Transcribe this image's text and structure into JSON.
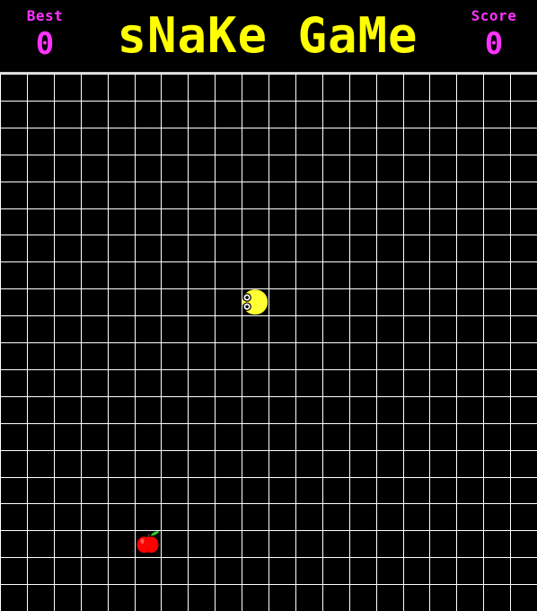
{
  "header": {
    "title": "sNaKe GaMe",
    "best": {
      "label": "Best",
      "value": "0"
    },
    "score": {
      "label": "Score",
      "value": "0"
    }
  },
  "colors": {
    "background": "#000000",
    "grid": "#ffffff",
    "title": "#ffff00",
    "stats": "#ff33ff",
    "snake": "#ffff33",
    "apple": "#ff0000",
    "leaf": "#33cc33"
  },
  "board": {
    "columns": 20,
    "rows": 20,
    "snake_head": {
      "col": 9,
      "row": 8,
      "direction": "right"
    },
    "apple": {
      "col": 5,
      "row": 17
    }
  }
}
